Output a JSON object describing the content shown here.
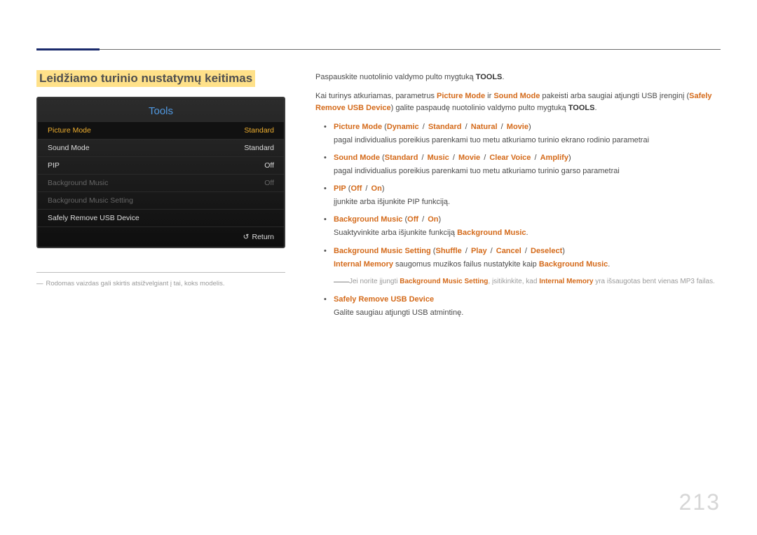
{
  "page_number": "213",
  "left": {
    "section_title": "Leidžiamo turinio nustatymų keitimas",
    "footnote": "Rodomas vaizdas gali skirtis atsižvelgiant į tai, koks modelis."
  },
  "tv": {
    "title": "Tools",
    "rows": [
      {
        "label": "Picture Mode",
        "value": "Standard",
        "state": "selected"
      },
      {
        "label": "Sound Mode",
        "value": "Standard",
        "state": "normal"
      },
      {
        "label": "PIP",
        "value": "Off",
        "state": "normal"
      },
      {
        "label": "Background Music",
        "value": "Off",
        "state": "disabled"
      },
      {
        "label": "Background Music Setting",
        "value": "",
        "state": "disabled"
      },
      {
        "label": "Safely Remove USB Device",
        "value": "",
        "state": "normal"
      }
    ],
    "return_label": "Return"
  },
  "right": {
    "intro1_pre": "Paspauskite nuotolinio valdymo pulto mygtuką ",
    "intro1_b": "TOOLS",
    "intro1_post": ".",
    "intro2_a": "Kai turinys atkuriamas, parametrus ",
    "intro2_pm": "Picture Mode",
    "intro2_b": " ir ",
    "intro2_sm": "Sound Mode",
    "intro2_c": " pakeisti arba saugiai atjungti USB įrenginį (",
    "intro2_sr": "Safely Remove USB Device",
    "intro2_d": ") galite paspaudę nuotolinio valdymo pulto mygtuką ",
    "intro2_tools": "TOOLS",
    "intro2_e": ".",
    "items": [
      {
        "head_parts": [
          "Picture Mode",
          " (",
          "Dynamic",
          " / ",
          "Standard",
          " / ",
          "Natural",
          " / ",
          "Movie",
          ")"
        ],
        "desc": "pagal individualius poreikius parenkami tuo metu atkuriamo turinio ekrano rodinio parametrai"
      },
      {
        "head_parts": [
          "Sound Mode",
          " (",
          "Standard",
          " / ",
          "Music",
          " / ",
          "Movie",
          " / ",
          "Clear Voice",
          " / ",
          "Amplify",
          ")"
        ],
        "desc": "pagal individualius poreikius parenkami tuo metu atkuriamo turinio garso parametrai"
      },
      {
        "head_parts": [
          "PIP",
          " (",
          "Off",
          " / ",
          "On",
          ")"
        ],
        "desc": "įjunkite arba išjunkite PIP funkciją."
      },
      {
        "head_parts": [
          "Background Music",
          " (",
          "Off",
          " / ",
          "On",
          ")"
        ],
        "desc_parts": [
          "Suaktyvinkite arba išjunkite funkciją ",
          "Background Music",
          "."
        ]
      },
      {
        "head_parts": [
          "Background Music Setting",
          " (",
          "Shuffle",
          " / ",
          "Play",
          " / ",
          "Cancel",
          " / ",
          "Deselect",
          ")"
        ],
        "desc_parts2": [
          "Internal Memory",
          " saugomus muzikos failus nustatykite kaip ",
          "Background Music",
          "."
        ]
      }
    ],
    "warn_parts": [
      "Jei norite įjungti ",
      "Background Music Setting",
      ", įsitikinkite, kad ",
      "Internal Memory",
      " yra išsaugotas bent vienas MP3 failas."
    ],
    "safely": {
      "title": "Safely Remove USB Device",
      "desc": "Galite saugiau atjungti USB atmintinę."
    }
  }
}
